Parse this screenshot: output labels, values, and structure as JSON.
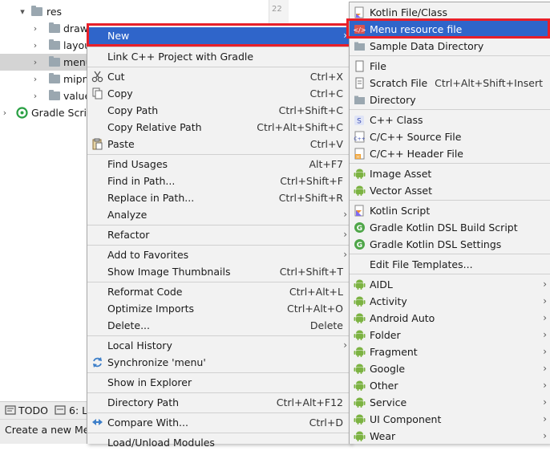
{
  "tree": {
    "rows": [
      {
        "label": "res",
        "chevron": "▾"
      },
      {
        "label": "draw",
        "chevron": "›"
      },
      {
        "label": "layou",
        "chevron": "›"
      },
      {
        "label": "menu",
        "chevron": "›"
      },
      {
        "label": "mipm",
        "chevron": "›"
      },
      {
        "label": "value",
        "chevron": "›"
      },
      {
        "label": "Gradle Script",
        "chevron": "›"
      }
    ],
    "gutter_line": "22"
  },
  "bottom": {
    "todo": "TODO",
    "tab2": "6: L"
  },
  "status": {
    "text": "Create a new Men"
  },
  "context_menu": {
    "items": [
      {
        "label": "New",
        "shortcut": "",
        "arrow": true
      },
      {
        "label": "Link C++ Project with Gradle",
        "shortcut": ""
      },
      {
        "label": "Cut",
        "shortcut": "Ctrl+X"
      },
      {
        "label": "Copy",
        "shortcut": "Ctrl+C"
      },
      {
        "label": "Copy Path",
        "shortcut": "Ctrl+Shift+C"
      },
      {
        "label": "Copy Relative Path",
        "shortcut": "Ctrl+Alt+Shift+C"
      },
      {
        "label": "Paste",
        "shortcut": "Ctrl+V"
      },
      {
        "label": "Find Usages",
        "shortcut": "Alt+F7"
      },
      {
        "label": "Find in Path...",
        "shortcut": "Ctrl+Shift+F"
      },
      {
        "label": "Replace in Path...",
        "shortcut": "Ctrl+Shift+R"
      },
      {
        "label": "Analyze",
        "shortcut": "",
        "arrow": true
      },
      {
        "label": "Refactor",
        "shortcut": "",
        "arrow": true
      },
      {
        "label": "Add to Favorites",
        "shortcut": "",
        "arrow": true
      },
      {
        "label": "Show Image Thumbnails",
        "shortcut": "Ctrl+Shift+T"
      },
      {
        "label": "Reformat Code",
        "shortcut": "Ctrl+Alt+L"
      },
      {
        "label": "Optimize Imports",
        "shortcut": "Ctrl+Alt+O"
      },
      {
        "label": "Delete...",
        "shortcut": "Delete"
      },
      {
        "label": "Local History",
        "shortcut": "",
        "arrow": true
      },
      {
        "label": "Synchronize 'menu'",
        "shortcut": ""
      },
      {
        "label": "Show in Explorer",
        "shortcut": ""
      },
      {
        "label": "Directory Path",
        "shortcut": "Ctrl+Alt+F12"
      },
      {
        "label": "Compare With...",
        "shortcut": "Ctrl+D"
      },
      {
        "label": "Load/Unload Modules",
        "shortcut": ""
      }
    ]
  },
  "new_submenu": {
    "items": [
      {
        "label": "Kotlin File/Class",
        "shortcut": ""
      },
      {
        "label": "Menu resource file",
        "shortcut": ""
      },
      {
        "label": "Sample Data Directory",
        "shortcut": ""
      },
      {
        "label": "File",
        "shortcut": ""
      },
      {
        "label": "Scratch File",
        "shortcut": "Ctrl+Alt+Shift+Insert"
      },
      {
        "label": "Directory",
        "shortcut": ""
      },
      {
        "label": "C++ Class",
        "shortcut": ""
      },
      {
        "label": "C/C++ Source File",
        "shortcut": ""
      },
      {
        "label": "C/C++ Header File",
        "shortcut": ""
      },
      {
        "label": "Image Asset",
        "shortcut": ""
      },
      {
        "label": "Vector Asset",
        "shortcut": ""
      },
      {
        "label": "Kotlin Script",
        "shortcut": ""
      },
      {
        "label": "Gradle Kotlin DSL Build Script",
        "shortcut": ""
      },
      {
        "label": "Gradle Kotlin DSL Settings",
        "shortcut": ""
      },
      {
        "label": "Edit File Templates...",
        "shortcut": ""
      },
      {
        "label": "AIDL",
        "shortcut": ""
      },
      {
        "label": "Activity",
        "shortcut": ""
      },
      {
        "label": "Android Auto",
        "shortcut": ""
      },
      {
        "label": "Folder",
        "shortcut": ""
      },
      {
        "label": "Fragment",
        "shortcut": ""
      },
      {
        "label": "Google",
        "shortcut": ""
      },
      {
        "label": "Other",
        "shortcut": ""
      },
      {
        "label": "Service",
        "shortcut": ""
      },
      {
        "label": "UI Component",
        "shortcut": ""
      },
      {
        "label": "Wear",
        "shortcut": ""
      }
    ]
  },
  "colors": {
    "highlight": "#2f65ca",
    "menu_bg": "#f2f2f2",
    "annotation": "#e8202a",
    "android": "#7cb342"
  }
}
